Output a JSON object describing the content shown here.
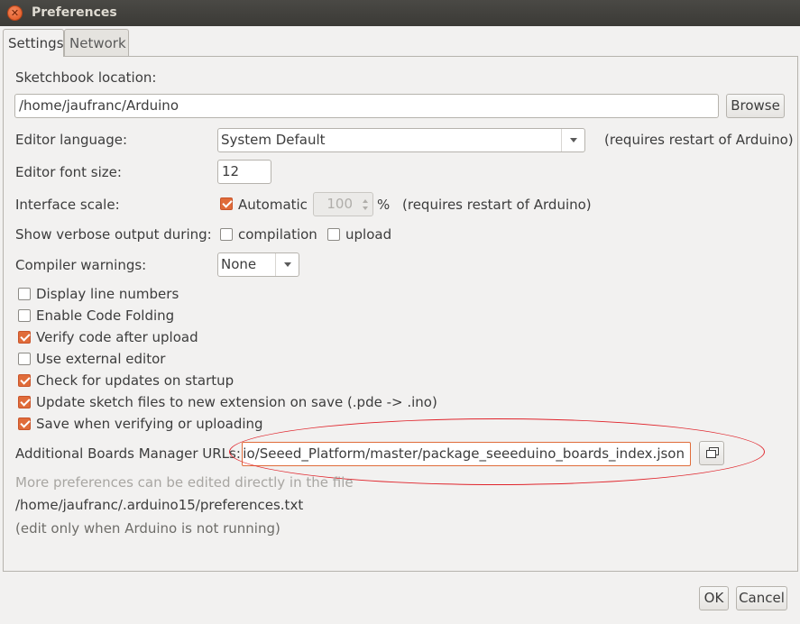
{
  "window": {
    "title": "Preferences"
  },
  "tabs": [
    {
      "label": "Settings",
      "active": true
    },
    {
      "label": "Network",
      "active": false
    }
  ],
  "settings": {
    "sketchbook_label": "Sketchbook location:",
    "sketchbook_value": "/home/jaufranc/Arduino",
    "browse_label": "Browse",
    "editor_language_label": "Editor language:",
    "editor_language_value": "System Default",
    "requires_restart": "(requires restart of Arduino)",
    "font_size_label": "Editor font size:",
    "font_size_value": "12",
    "interface_scale_label": "Interface scale:",
    "automatic_label": "Automatic",
    "automatic_checked": true,
    "scale_value": "100",
    "percent": "%",
    "verbose_label": "Show verbose output during:",
    "compilation_label": "compilation",
    "upload_label": "upload",
    "compiler_warnings_label": "Compiler warnings:",
    "compiler_warnings_value": "None",
    "checkboxes": [
      {
        "label": "Display line numbers",
        "checked": false
      },
      {
        "label": "Enable Code Folding",
        "checked": false
      },
      {
        "label": "Verify code after upload",
        "checked": true
      },
      {
        "label": "Use external editor",
        "checked": false
      },
      {
        "label": "Check for updates on startup",
        "checked": true
      },
      {
        "label": "Update sketch files to new extension on save (.pde -> .ino)",
        "checked": true
      },
      {
        "label": "Save when verifying or uploading",
        "checked": true
      }
    ],
    "boards_url_label": "Additional Boards Manager URLs:",
    "boards_url_value": "udio/Seeed_Platform/master/package_seeeduino_boards_index.json",
    "more_prefs": "More preferences can be edited directly in the file",
    "prefs_path": "/home/jaufranc/.arduino15/preferences.txt",
    "edit_note": "(edit only when Arduino is not running)"
  },
  "footer": {
    "ok_label": "OK",
    "cancel_label": "Cancel"
  },
  "colors": {
    "accent": "#e06c3a",
    "highlight": "#e0242b"
  }
}
